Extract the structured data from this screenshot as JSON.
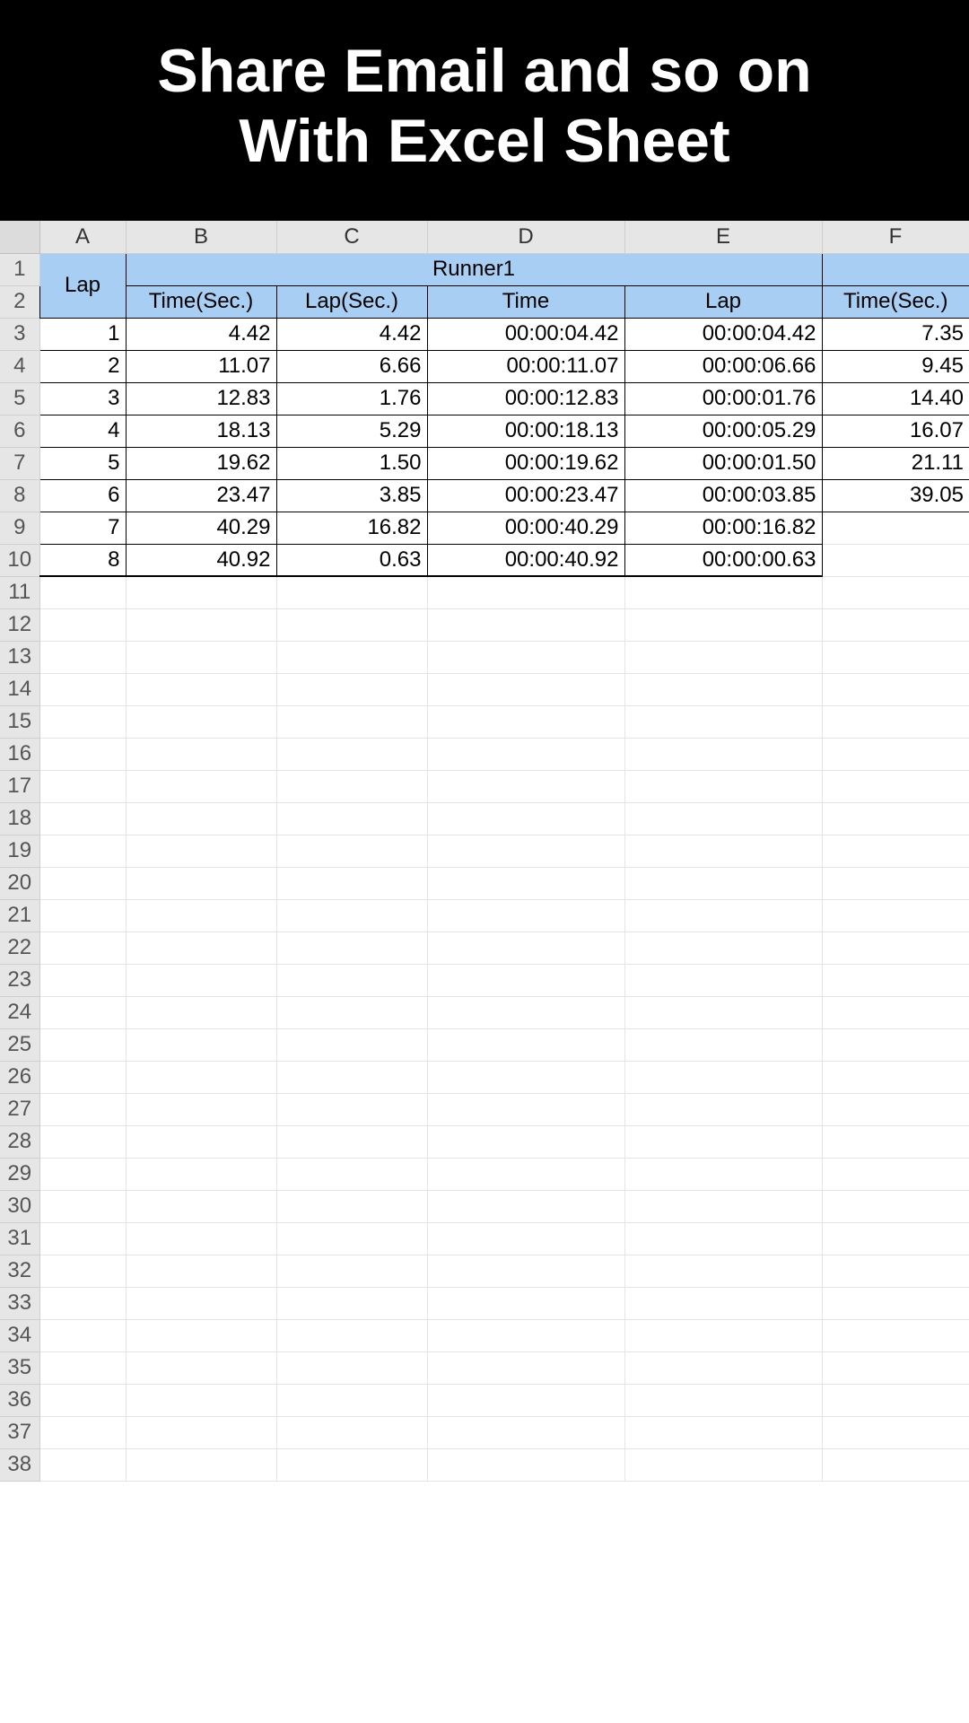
{
  "banner": {
    "line1": "Share Email and so on",
    "line2": "With Excel Sheet"
  },
  "colLetters": [
    "A",
    "B",
    "C",
    "D",
    "E",
    "F"
  ],
  "header": {
    "lap": "Lap",
    "runner1": "Runner1",
    "sub": {
      "timeSec": "Time(Sec.)",
      "lapSec": "Lap(Sec.)",
      "time": "Time",
      "lap": "Lap",
      "timeSecF": "Time(Sec.)"
    }
  },
  "rows": [
    {
      "n": "1",
      "a": "1",
      "b": "4.42",
      "c": "4.42",
      "d": "00:00:04.42",
      "e": "00:00:04.42",
      "f": "7.35"
    },
    {
      "n": "2",
      "a": "2",
      "b": "11.07",
      "c": "6.66",
      "d": "00:00:11.07",
      "e": "00:00:06.66",
      "f": "9.45"
    },
    {
      "n": "3",
      "a": "3",
      "b": "12.83",
      "c": "1.76",
      "d": "00:00:12.83",
      "e": "00:00:01.76",
      "f": "14.40"
    },
    {
      "n": "4",
      "a": "4",
      "b": "18.13",
      "c": "5.29",
      "d": "00:00:18.13",
      "e": "00:00:05.29",
      "f": "16.07"
    },
    {
      "n": "5",
      "a": "5",
      "b": "19.62",
      "c": "1.50",
      "d": "00:00:19.62",
      "e": "00:00:01.50",
      "f": "21.11"
    },
    {
      "n": "6",
      "a": "6",
      "b": "23.47",
      "c": "3.85",
      "d": "00:00:23.47",
      "e": "00:00:03.85",
      "f": "39.05"
    },
    {
      "n": "7",
      "a": "7",
      "b": "40.29",
      "c": "16.82",
      "d": "00:00:40.29",
      "e": "00:00:16.82",
      "f": ""
    },
    {
      "n": "8",
      "a": "8",
      "b": "40.92",
      "c": "0.63",
      "d": "00:00:40.92",
      "e": "00:00:00.63",
      "f": ""
    }
  ],
  "emptyRowStart": 11,
  "emptyRowEnd": 38
}
